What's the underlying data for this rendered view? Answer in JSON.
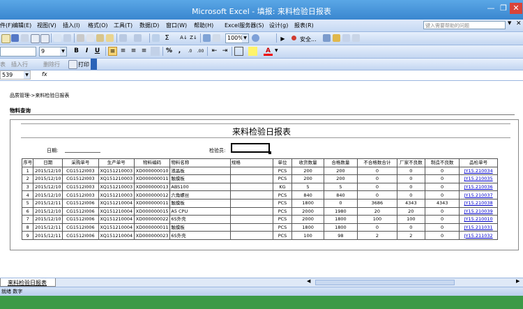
{
  "window": {
    "title": "Microsoft Excel - 填报: 来料检验日报表"
  },
  "menubar": {
    "items": [
      "件(F)",
      "编辑(E)",
      "视图(V)",
      "插入(I)",
      "格式(O)",
      "工具(T)",
      "数据(D)",
      "窗口(W)",
      "帮助(H)",
      "Excel服务器(S)",
      "设计(g)",
      "报表(R)"
    ],
    "help_placeholder": "键入需要帮助的问题"
  },
  "toolbar": {
    "zoom": "100%",
    "security_label": "安全...",
    "font_size": "9",
    "bold": "B",
    "italic": "I",
    "underline": "U",
    "percent": "%",
    "comma": ",",
    "font_color_letter": "A"
  },
  "toolbar3": {
    "insert_row": "插入行",
    "delete_row": "删除行",
    "print": "打印"
  },
  "formula_bar": {
    "name_box": "539",
    "fx": "fx",
    "content": ""
  },
  "page": {
    "breadcrumb": "品质管理->来料检验日报表",
    "section": "物料查询"
  },
  "report": {
    "title": "来料检验日报表",
    "date_label": "日期:",
    "date_value": "",
    "inspector_label": "检验员:",
    "inspector_value": "",
    "columns": [
      "序号",
      "日期",
      "采购单号",
      "生产单号",
      "物料编码",
      "物料名称",
      "规格",
      "单位",
      "收货数量",
      "合格数量",
      "不合格数合计",
      "厂家不良数",
      "制造不良数",
      "品检单号"
    ],
    "rows": [
      [
        "1",
        "2015/12/10",
        "CG1512I003",
        "XQ151210003",
        "XD000000010",
        "液晶板",
        "",
        "PCS",
        "200",
        "200",
        "0",
        "0",
        "0",
        "JY15.210034"
      ],
      [
        "2",
        "2015/12/10",
        "CG1512I003",
        "XQ151210003",
        "XD000000011",
        "触摸板",
        "",
        "PCS",
        "200",
        "200",
        "0",
        "0",
        "0",
        "JY15.210035"
      ],
      [
        "3",
        "2015/12/10",
        "CG1512I003",
        "XQ151210003",
        "XD000000013",
        "ABS100",
        "",
        "KG",
        "5",
        "5",
        "0",
        "0",
        "0",
        "JY15.210036"
      ],
      [
        "4",
        "2015/12/10",
        "CG1512I003",
        "XQ151210003",
        "XD000000012",
        "六角螺丝",
        "",
        "PCS",
        "840",
        "840",
        "0",
        "0",
        "0",
        "JY15.210037"
      ],
      [
        "5",
        "2015/12/11",
        "CG1512I006",
        "XQ151210004",
        "XD000000011",
        "触摸板",
        "",
        "PCS",
        "1800",
        "0",
        "3686",
        "4343",
        "4343",
        "JY15.210038"
      ],
      [
        "6",
        "2015/12/10",
        "CG1512I006",
        "XQ151210004",
        "XD000000015",
        "A5 CPU",
        "",
        "PCS",
        "2000",
        "1980",
        "20",
        "20",
        "0",
        "JY15.210039"
      ],
      [
        "7",
        "2015/12/10",
        "CG1512I006",
        "XQ151210004",
        "XD000000022",
        "6S外壳",
        "",
        "PCS",
        "2000",
        "1800",
        "100",
        "100",
        "0",
        "JY15.210010"
      ],
      [
        "8",
        "2015/12/11",
        "CG1512I006",
        "XQ151210004",
        "XD000000011",
        "触摸板",
        "",
        "PCS",
        "1800",
        "1800",
        "0",
        "0",
        "0",
        "JY15.211031"
      ],
      [
        "9",
        "2015/12/11",
        "CG1512I006",
        "XQ151210004",
        "XD000000023",
        "6S外壳",
        "",
        "PCS",
        "100",
        "98",
        "2",
        "2",
        "0",
        "JY15.211032"
      ]
    ]
  },
  "sheet_tabs": {
    "active": "来料检验日报表"
  },
  "status": {
    "text": "就绪   数字"
  }
}
